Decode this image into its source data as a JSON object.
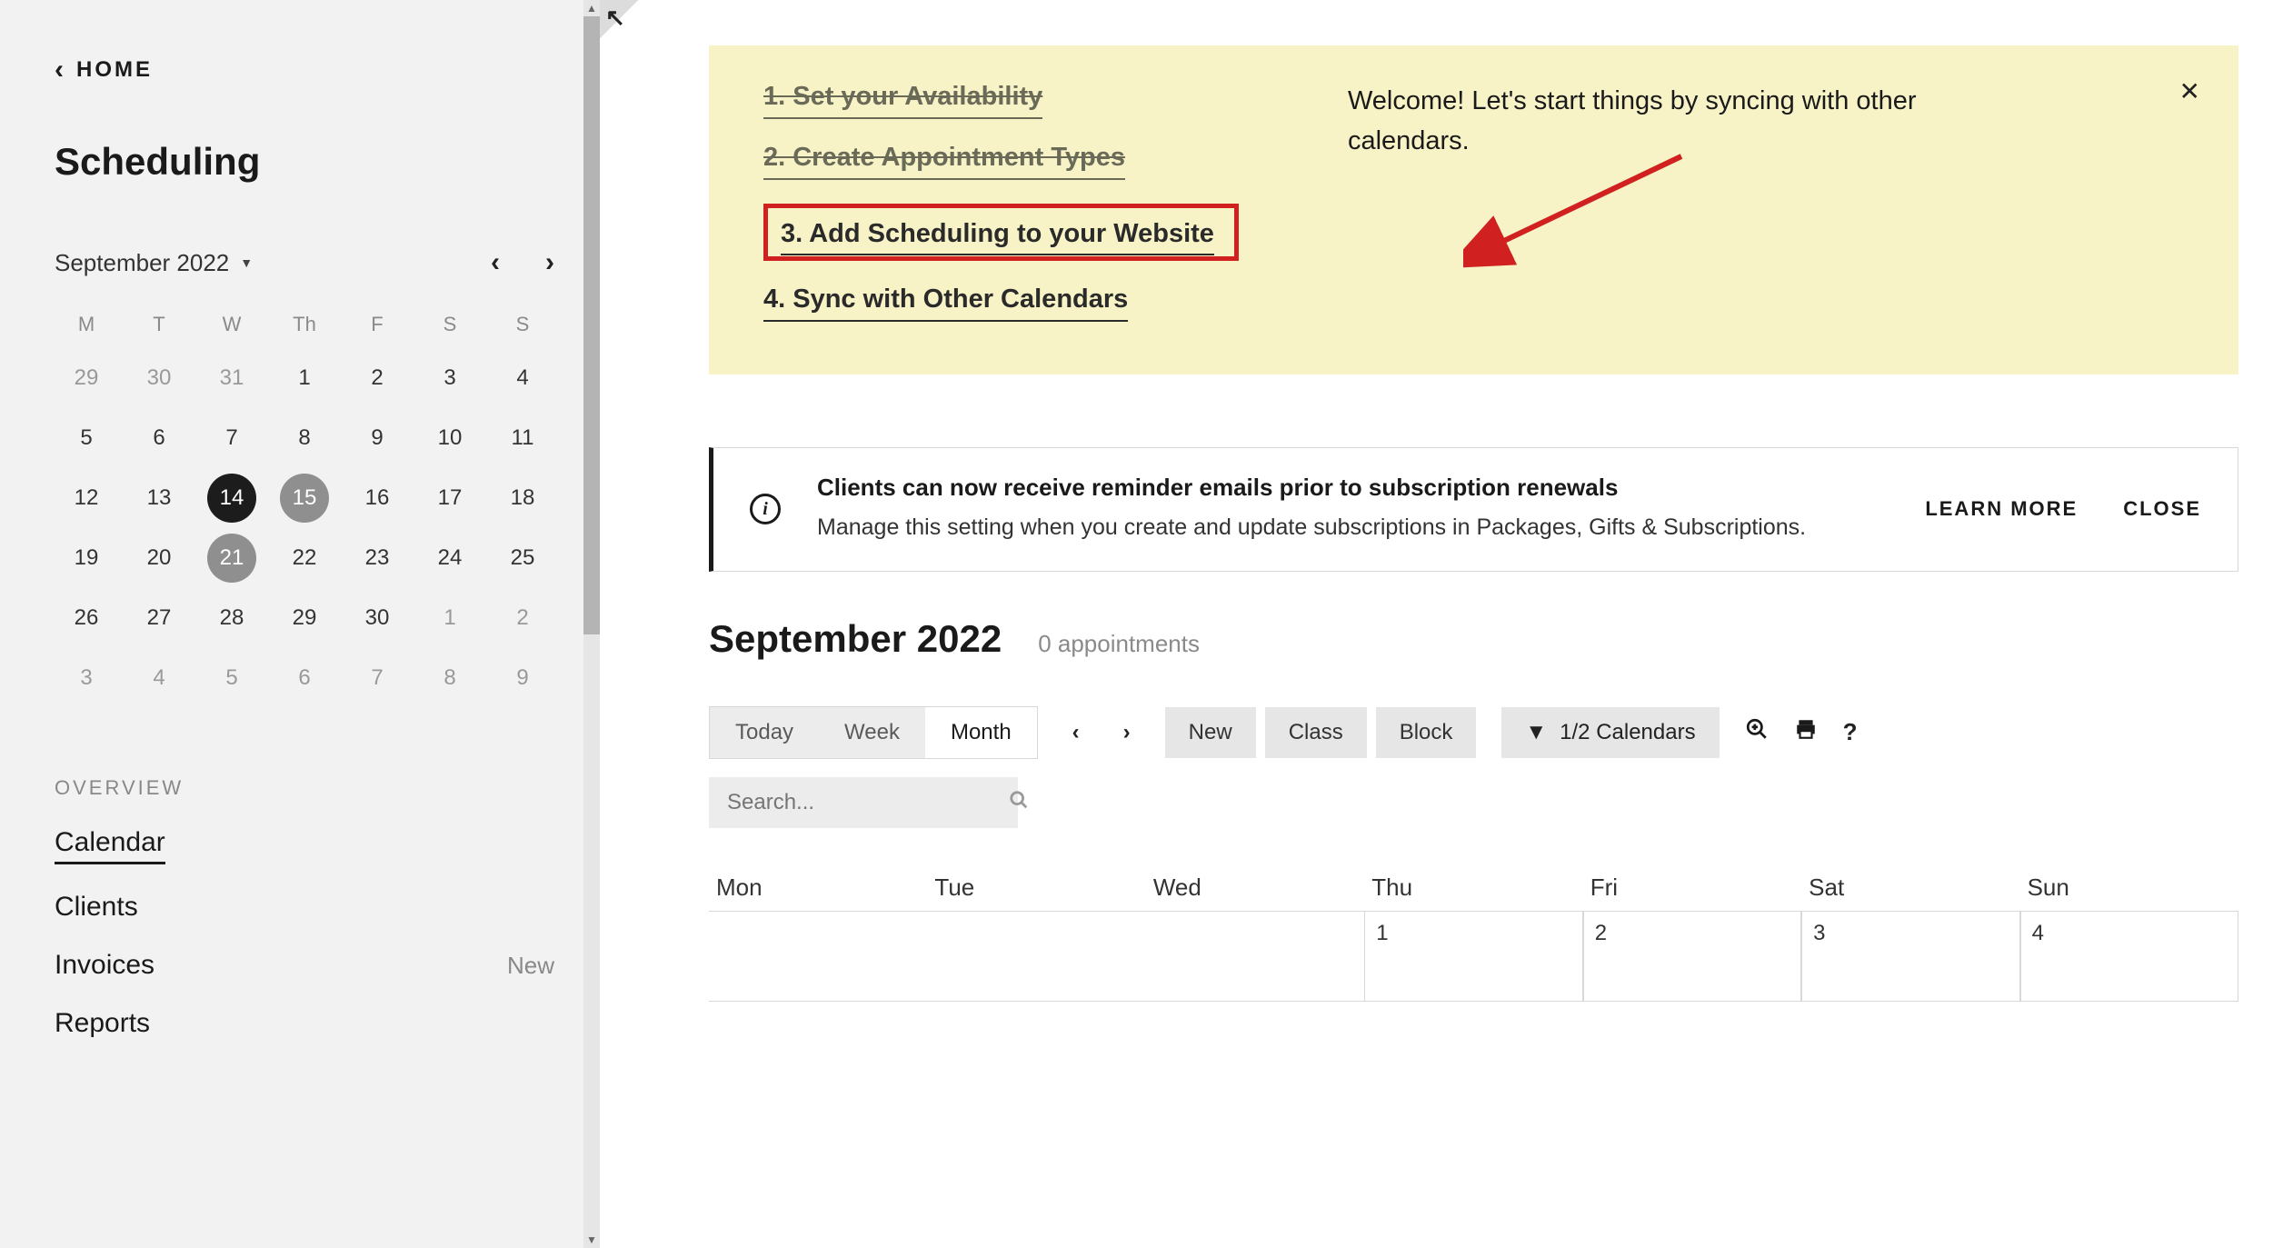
{
  "sidebar": {
    "home_label": "HOME",
    "title": "Scheduling",
    "month_label": "September 2022",
    "day_headers": [
      "M",
      "T",
      "W",
      "Th",
      "F",
      "S",
      "S"
    ],
    "mini_rows": [
      [
        {
          "n": "29",
          "dim": true
        },
        {
          "n": "30",
          "dim": true
        },
        {
          "n": "31",
          "dim": true
        },
        {
          "n": "1"
        },
        {
          "n": "2"
        },
        {
          "n": "3"
        },
        {
          "n": "4"
        }
      ],
      [
        {
          "n": "5"
        },
        {
          "n": "6"
        },
        {
          "n": "7"
        },
        {
          "n": "8"
        },
        {
          "n": "9"
        },
        {
          "n": "10"
        },
        {
          "n": "11"
        }
      ],
      [
        {
          "n": "12"
        },
        {
          "n": "13"
        },
        {
          "n": "14",
          "today": true
        },
        {
          "n": "15",
          "marked": true
        },
        {
          "n": "16"
        },
        {
          "n": "17"
        },
        {
          "n": "18"
        }
      ],
      [
        {
          "n": "19"
        },
        {
          "n": "20"
        },
        {
          "n": "21",
          "marked": true
        },
        {
          "n": "22"
        },
        {
          "n": "23"
        },
        {
          "n": "24"
        },
        {
          "n": "25"
        }
      ],
      [
        {
          "n": "26"
        },
        {
          "n": "27"
        },
        {
          "n": "28"
        },
        {
          "n": "29"
        },
        {
          "n": "30"
        },
        {
          "n": "1",
          "dim": true
        },
        {
          "n": "2",
          "dim": true
        }
      ],
      [
        {
          "n": "3",
          "dim": true
        },
        {
          "n": "4",
          "dim": true
        },
        {
          "n": "5",
          "dim": true
        },
        {
          "n": "6",
          "dim": true
        },
        {
          "n": "7",
          "dim": true
        },
        {
          "n": "8",
          "dim": true
        },
        {
          "n": "9",
          "dim": true
        }
      ]
    ],
    "overview_label": "OVERVIEW",
    "links": {
      "calendar": "Calendar",
      "clients": "Clients",
      "invoices": "Invoices",
      "invoices_badge": "New",
      "reports": "Reports"
    }
  },
  "banner": {
    "steps": {
      "s1": "1. Set your Availability",
      "s2": "2. Create Appointment Types",
      "s3": "3. Add Scheduling to your Website",
      "s4": "4. Sync with Other Calendars"
    },
    "welcome": "Welcome! Let's start things by syncing with other calendars."
  },
  "notice": {
    "title": "Clients can now receive reminder emails prior to subscription renewals",
    "desc": "Manage this setting when you create and update subscriptions in Packages, Gifts & Subscriptions.",
    "learn": "LEARN MORE",
    "close": "CLOSE"
  },
  "main": {
    "month_heading": "September 2022",
    "appt_count": "0 appointments",
    "seg": {
      "today": "Today",
      "week": "Week",
      "month": "Month"
    },
    "pills": {
      "new": "New",
      "class": "Class",
      "block": "Block"
    },
    "filter_label": "1/2 Calendars",
    "search_placeholder": "Search...",
    "big_headers": [
      "Mon",
      "Tue",
      "Wed",
      "Thu",
      "Fri",
      "Sat",
      "Sun"
    ],
    "big_first_row": [
      "",
      "",
      "",
      "1",
      "2",
      "3",
      "4"
    ]
  }
}
